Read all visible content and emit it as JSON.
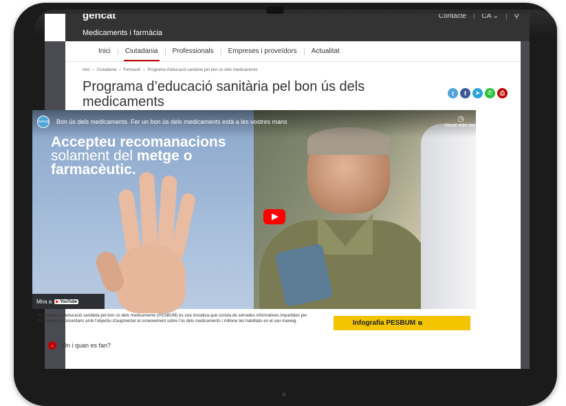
{
  "header": {
    "brand": "gencat",
    "site_title": "Medicaments i farmàcia",
    "contact": "Contacte",
    "language": "CA",
    "search_icon": "search-icon"
  },
  "nav": {
    "items": [
      "Inici",
      "Ciutadania",
      "Professionals",
      "Empreses i proveïdors",
      "Actualitat"
    ],
    "active": "Ciutadania"
  },
  "breadcrumb": [
    "Inici",
    "Ciutadania",
    "Formació",
    "Programa d'educació sanitària pel bon ús dels medicaments"
  ],
  "page": {
    "title": "Programa d’educació sanitària pel bon ús dels medicaments"
  },
  "share": {
    "icons": [
      "twitter-icon",
      "facebook-icon",
      "telegram-icon",
      "whatsapp-icon",
      "print-icon"
    ],
    "colors": [
      "#4fa3d9",
      "#3b5998",
      "#2aa3d9",
      "#27c33a",
      "#c00000"
    ]
  },
  "video": {
    "channel_logo_text": "Gencat",
    "title": "Bon ús dels medicaments. Fer un bon ús dels medicaments està a les vostres mans",
    "watch_later": "Veure més tard",
    "share": "Comparteix",
    "overlay_line1": "Accepteu recomanacions",
    "overlay_line2a": "solament del",
    "overlay_line2b": "metge o",
    "overlay_line3": "farmacèutic.",
    "watch_on": "Mira a",
    "youtube": "YouTube"
  },
  "description": "El Programa d'educació sanitària pel bon ús dels medicaments (PESBUM) és una iniciativa que consta de xerrades informatives impartides per farmacèutics comunitaris amb l'objectiu d'augmentar el coneixement sobre l'ús dels medicaments i millorar les habilitats en el seu maneig.",
  "infografia": {
    "label": "Infografia PESBUM",
    "icon": "external-link-icon"
  },
  "faq": {
    "label": "On i quan es fan?",
    "icon": "chevron-down-icon"
  }
}
